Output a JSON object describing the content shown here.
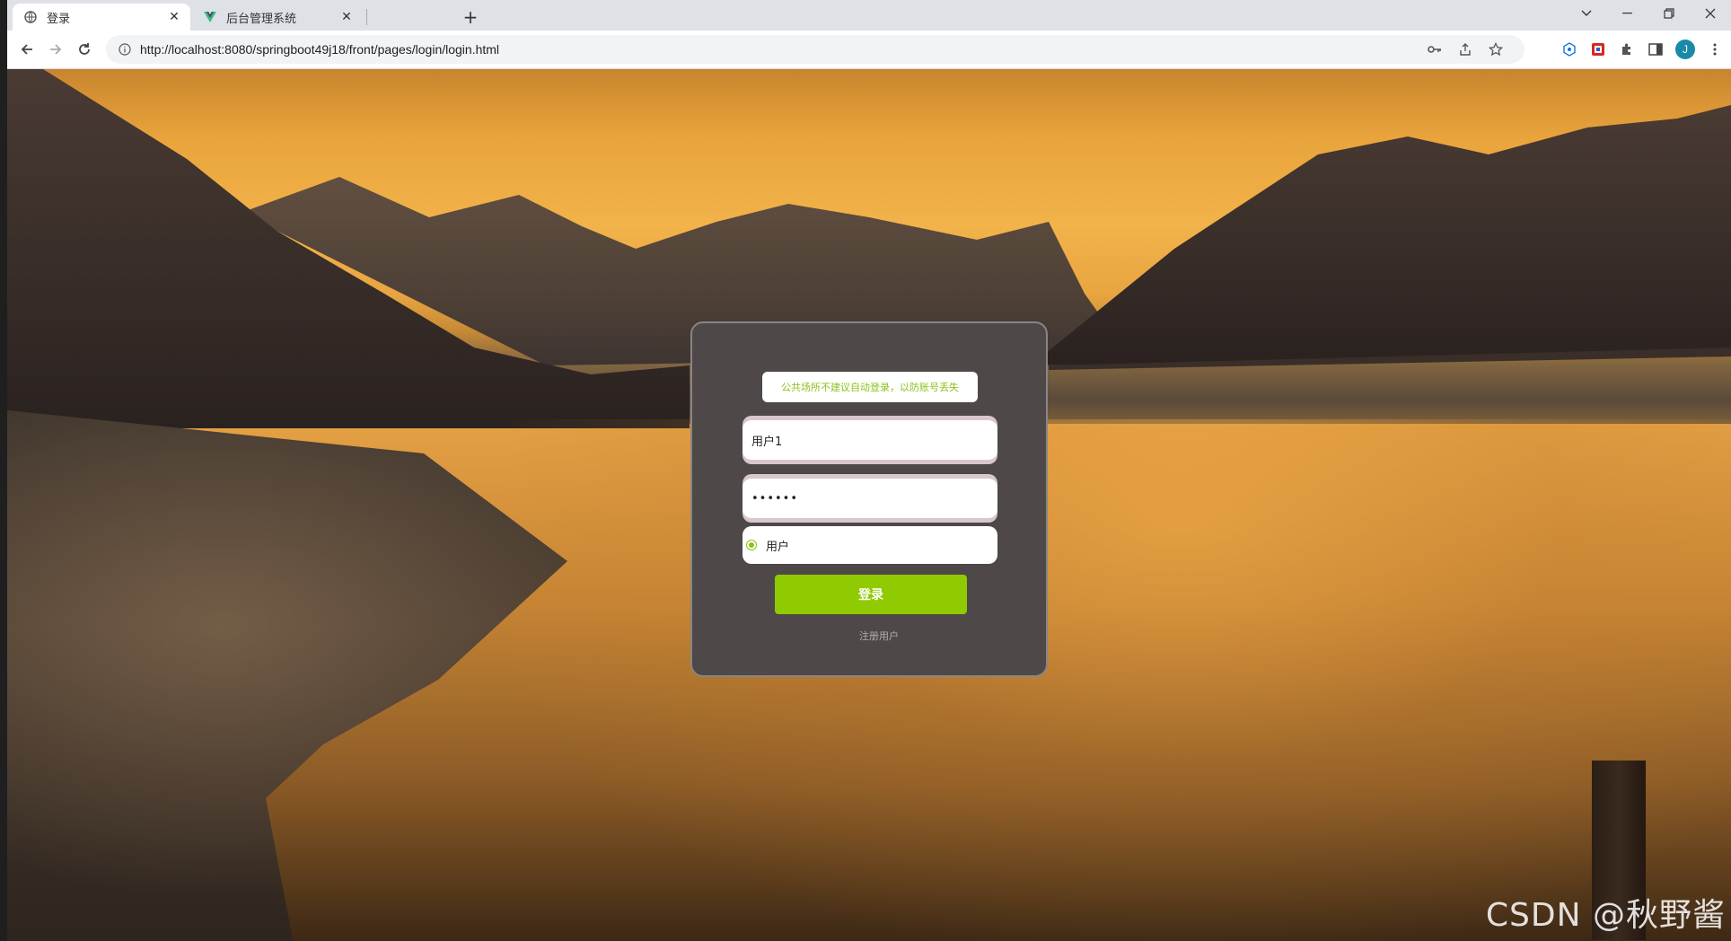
{
  "browser": {
    "tabs": [
      {
        "title": "登录",
        "close": "✕"
      },
      {
        "title": "后台管理系统",
        "close": "✕"
      }
    ],
    "new_tab": "+",
    "url": "http://localhost:8080/springboot49j18/front/pages/login/login.html",
    "profile_initial": "J"
  },
  "login": {
    "notice": "公共场所不建议自动登录，以防账号丢失",
    "username_value": "用户1",
    "password_value": "••••••",
    "role_option": "用户",
    "login_button": "登录",
    "register_link": "注册用户"
  },
  "watermark": "CSDN @秋野酱",
  "colors": {
    "accent_green": "#8fcb00",
    "card_bg": "#4e4848",
    "notice_text": "#8cc11b"
  }
}
